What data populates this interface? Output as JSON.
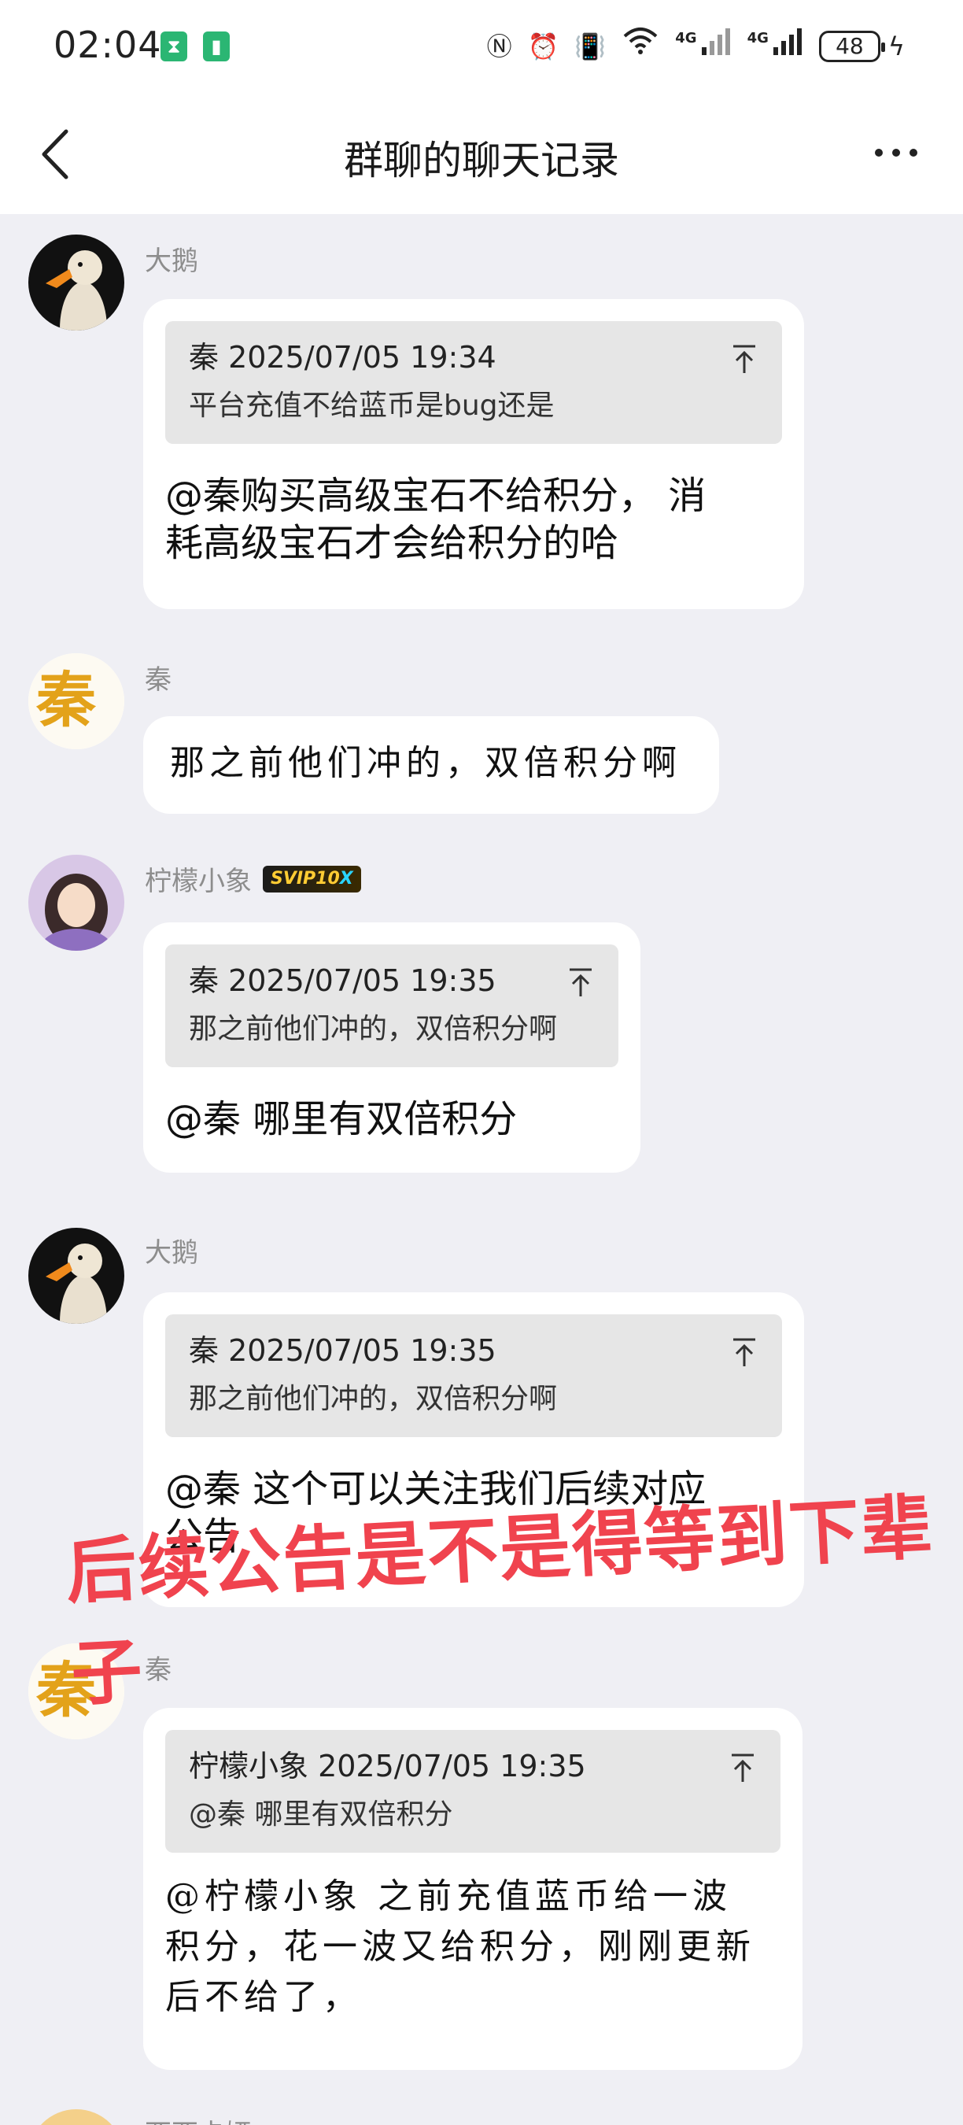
{
  "status_bar": {
    "time": "02:04",
    "net1": "4G",
    "net2": "4G",
    "battery": "48"
  },
  "nav": {
    "title": "群聊的聊天记录"
  },
  "messages": [
    {
      "sender": "大鹅",
      "quote_head": "秦 2025/07/05 19:34",
      "quote_text": "平台充值不给蓝币是bug还是",
      "text_line1": "@秦购买高级宝石不给积分， 消",
      "text_line2": "耗高级宝石才会给积分的哈"
    },
    {
      "sender": "秦",
      "text": "那之前他们冲的，双倍积分啊"
    },
    {
      "sender": "柠檬小象",
      "badge": "SVIP10",
      "quote_head": "秦 2025/07/05 19:35",
      "quote_text": "那之前他们冲的，双倍积分啊",
      "text": "@秦 哪里有双倍积分"
    },
    {
      "sender": "大鹅",
      "quote_head": "秦 2025/07/05 19:35",
      "quote_text": "那之前他们冲的，双倍积分啊",
      "text_line1": "@秦 这个可以关注我们后续对应",
      "text_line2": "公告"
    },
    {
      "sender": "秦",
      "quote_head": "柠檬小象 2025/07/05 19:35",
      "quote_text": "@秦 哪里有双倍积分",
      "text_line1": "@柠檬小象 之前充值蓝币给一波",
      "text_line2": "积分，花一波又给积分，刚刚更新",
      "text_line3": "后不给了，"
    }
  ],
  "overlay": {
    "line1": "后续公告是不是得等到下辈",
    "line2": "子"
  },
  "next_sender": "西西卡娅"
}
